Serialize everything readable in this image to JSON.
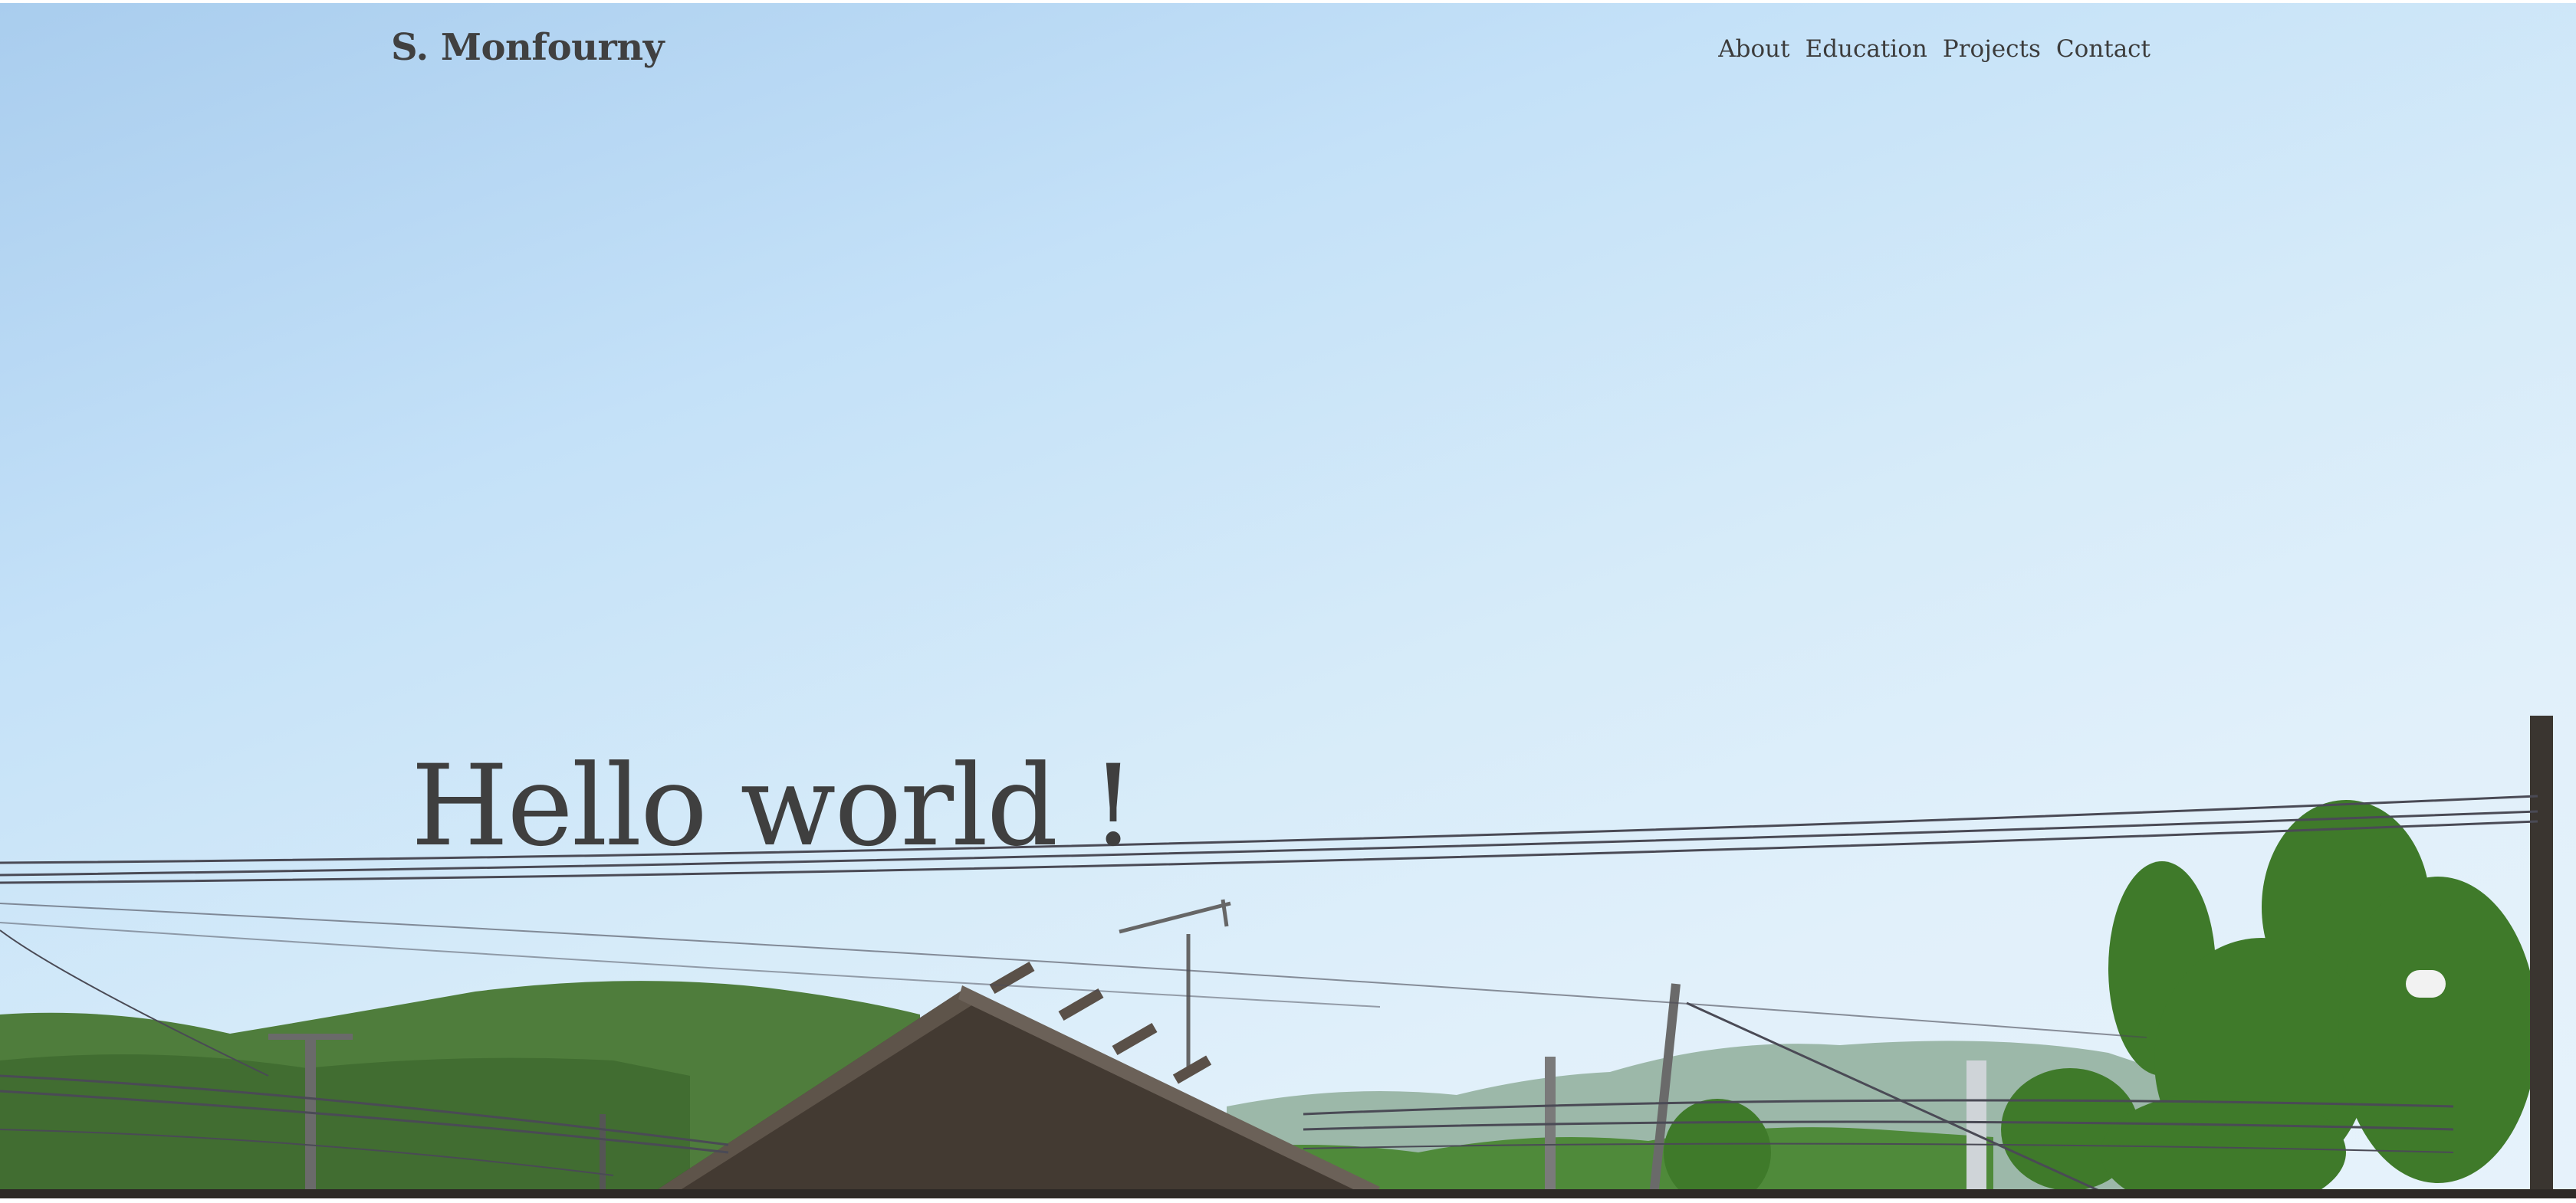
{
  "site": {
    "brand": "S. Monfourny"
  },
  "nav": {
    "items": [
      {
        "label": "About"
      },
      {
        "label": "Education"
      },
      {
        "label": "Projects"
      },
      {
        "label": "Contact"
      }
    ]
  },
  "hero": {
    "title": "Hello world !",
    "background_image": "photo of a blue sky over forested hills with a wooden roof, power lines, antenna and trees",
    "colors": {
      "text": "#404040",
      "sky_top": "#a9cdee",
      "sky_bottom": "#e6f2fb",
      "hills": "#5a8a4a",
      "roof": "#4a4038"
    }
  }
}
